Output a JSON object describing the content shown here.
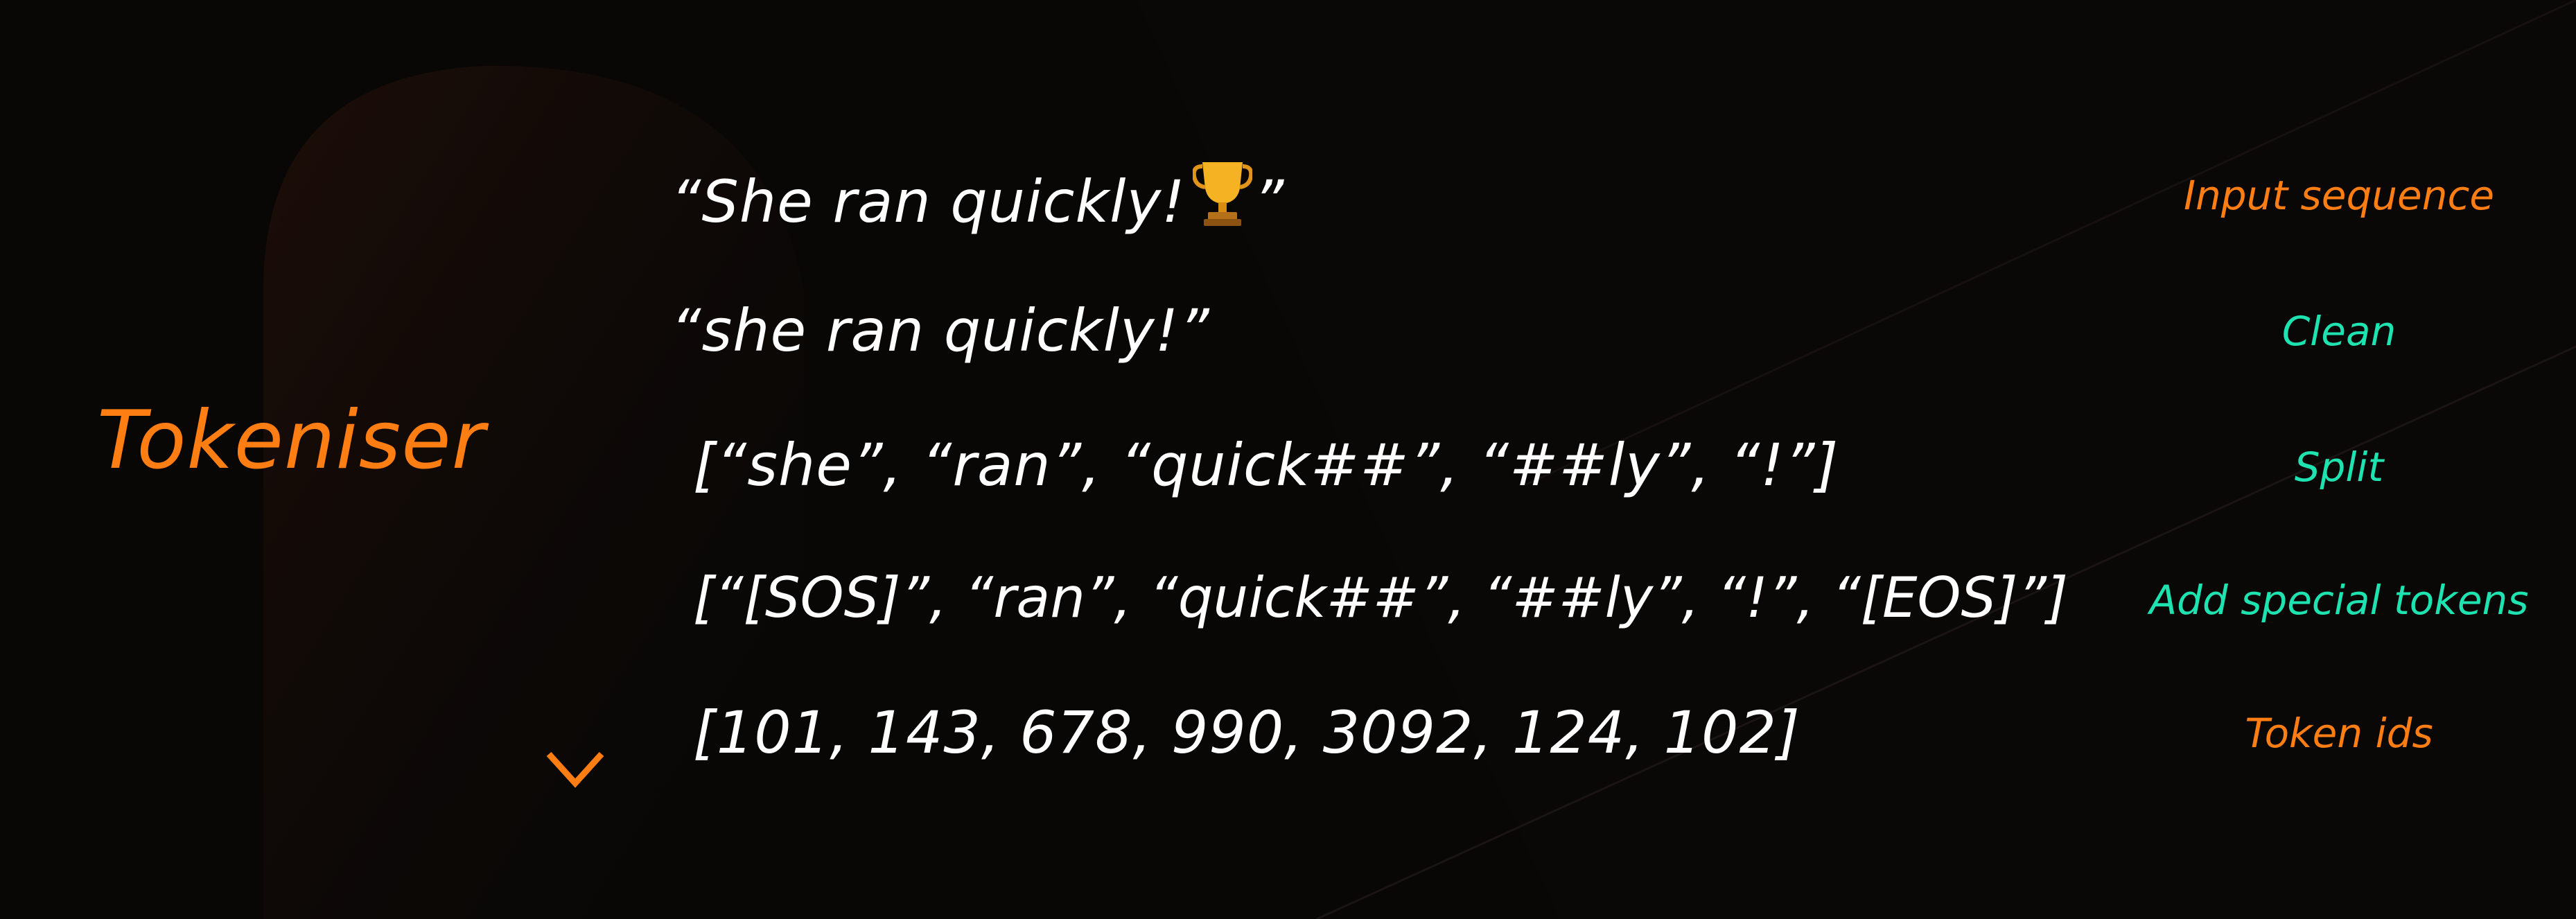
{
  "title": "Tokeniser",
  "colors": {
    "accent": "#ff7e14",
    "label_green": "#1ee3b0",
    "text": "#ffffff",
    "background": "#080706"
  },
  "steps": [
    {
      "text_before": "“She ran quickly!",
      "icon": "trophy-icon",
      "text_after": "”",
      "label": "Input sequence",
      "label_color": "#ff7e14"
    },
    {
      "text": "“she ran quickly!”",
      "label": "Clean",
      "label_color": "#1ee3b0"
    },
    {
      "text": "[“she”, “ran”, “quick##”, “##ly”, “!”]",
      "label": "Split",
      "label_color": "#1ee3b0"
    },
    {
      "text": "[“[SOS]”, “ran”, “quick##”, “##ly”, “!”, “[EOS]”]",
      "label": "Add special tokens",
      "label_color": "#1ee3b0"
    },
    {
      "text": "[101, 143, 678, 990, 3092, 124, 102]",
      "label": "Token ids",
      "label_color": "#ff7e14"
    }
  ]
}
